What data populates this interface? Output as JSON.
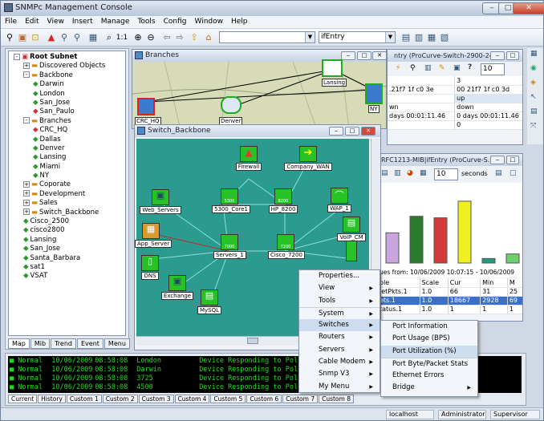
{
  "app": {
    "title": "SNMPc Management Console"
  },
  "menu": [
    "File",
    "Edit",
    "View",
    "Insert",
    "Manage",
    "Tools",
    "Config",
    "Window",
    "Help"
  ],
  "toolbar": {
    "zoom_label": "1:1",
    "combo_left": "",
    "combo_right": "ifEntry"
  },
  "tree": {
    "items": [
      {
        "label": "Root Subnet",
        "icon": "root",
        "depth": 0,
        "exp": "-"
      },
      {
        "label": "Discovered Objects",
        "icon": "folder",
        "depth": 1,
        "exp": "+"
      },
      {
        "label": "Backbone",
        "icon": "folder",
        "depth": 1,
        "exp": "-"
      },
      {
        "label": "Darwin",
        "icon": "diamond-green",
        "depth": 2
      },
      {
        "label": "London",
        "icon": "diamond-green",
        "depth": 2
      },
      {
        "label": "San_Jose",
        "icon": "diamond-green",
        "depth": 2
      },
      {
        "label": "San_Paulo",
        "icon": "diamond-red",
        "depth": 2
      },
      {
        "label": "Branches",
        "icon": "folder",
        "depth": 1,
        "exp": "-"
      },
      {
        "label": "CRC_HQ",
        "icon": "diamond-red",
        "depth": 2
      },
      {
        "label": "Dallas",
        "icon": "diamond-green",
        "depth": 2
      },
      {
        "label": "Denver",
        "icon": "diamond-green",
        "depth": 2
      },
      {
        "label": "Lansing",
        "icon": "diamond-green",
        "depth": 2
      },
      {
        "label": "Miami",
        "icon": "diamond-green",
        "depth": 2
      },
      {
        "label": "NY",
        "icon": "diamond-green",
        "depth": 2
      },
      {
        "label": "Coporate",
        "icon": "folder",
        "depth": 1,
        "exp": "+"
      },
      {
        "label": "Development",
        "icon": "folder",
        "depth": 1,
        "exp": "+"
      },
      {
        "label": "Sales",
        "icon": "folder",
        "depth": 1,
        "exp": "+"
      },
      {
        "label": "Switch_Backbone",
        "icon": "folder",
        "depth": 1,
        "exp": "+"
      },
      {
        "label": "Cisco_2500",
        "icon": "diamond-green",
        "depth": 1
      },
      {
        "label": "cisco2800",
        "icon": "diamond-green",
        "depth": 1
      },
      {
        "label": "Lansing",
        "icon": "diamond-green",
        "depth": 1
      },
      {
        "label": "San_Jose",
        "icon": "diamond-green",
        "depth": 1
      },
      {
        "label": "Santa_Barbara",
        "icon": "diamond-green",
        "depth": 1
      },
      {
        "label": "sat1",
        "icon": "diamond-green",
        "depth": 1
      },
      {
        "label": "VSAT",
        "icon": "diamond-green",
        "depth": 1
      }
    ]
  },
  "left_tabs": [
    "Map",
    "Mib",
    "Trend",
    "Event",
    "Menu"
  ],
  "branches": {
    "title": "Branches",
    "nodes": [
      "Lansing",
      "NY",
      "CRC_HQ",
      "Denver"
    ]
  },
  "switch_backbone": {
    "title": "Switch_Backbone",
    "nodes": [
      "Firewall",
      "Company_WAN",
      "5300_Core1",
      "HP_8200",
      "Web_Servers",
      "WAP_1",
      "App_Server",
      "VoIP_CM",
      "Servers_1",
      "Cisco_7200",
      "DNS",
      "Exchange",
      "MySQL"
    ],
    "small_labels": {
      "core1": "5300",
      "hp": "8200",
      "servers": "7000",
      "cisco": "7200"
    }
  },
  "if_table": {
    "title": "ntry (ProCurve-Switch-2900-24G)",
    "combo": "10",
    "rows": [
      [
        "",
        "3"
      ],
      [
        ".21f7 1f c0 3e",
        "00 21f7 1f c0 3d"
      ],
      [
        "",
        "up"
      ],
      [
        "wn",
        "down"
      ],
      [
        "days 00:01:11.46",
        "0 days 00:01:11.46"
      ],
      [
        "",
        "0"
      ]
    ]
  },
  "rfc": {
    "title": "RFC1213-MIB|ifEntry (ProCurve-S...",
    "spin_value": "10",
    "spin_unit": "seconds",
    "range": "ues from: 10/06/2009 10:07:15 - 10/06/2009 10:13:14",
    "headers": [
      "ble",
      "Scale",
      "Cur",
      "Min",
      "M"
    ],
    "rows": [
      [
        "ietPkts.1",
        "1.0",
        "66",
        "31",
        "25"
      ],
      [
        "ets.1",
        "1.0",
        "18667",
        "2928",
        "69"
      ],
      [
        "tatus.1",
        "1.0",
        "1",
        "1",
        "1"
      ]
    ],
    "bars": [
      {
        "color": "#c9a6e0",
        "value": 40
      },
      {
        "color": "#2c7a2c",
        "value": 62
      },
      {
        "color": "#d23a3a",
        "value": 60
      },
      {
        "color": "#f0f020",
        "value": 82
      },
      {
        "color": "#1e9a80",
        "value": 6
      },
      {
        "color": "#6cd06c",
        "value": 12
      }
    ]
  },
  "context_menu": {
    "items": [
      {
        "label": "Properties...",
        "arrow": false
      },
      {
        "label": "View",
        "arrow": true
      },
      {
        "label": "Tools",
        "arrow": true
      },
      {
        "label": "System",
        "arrow": true
      },
      {
        "label": "Switches",
        "arrow": true,
        "highlight": true
      },
      {
        "label": "Routers",
        "arrow": true
      },
      {
        "label": "Servers",
        "arrow": true
      },
      {
        "label": "Cable Modem",
        "arrow": true
      },
      {
        "label": "Snmp V3",
        "arrow": true
      },
      {
        "label": "My Menu",
        "arrow": true
      }
    ]
  },
  "submenu": {
    "items": [
      {
        "label": "Port Information"
      },
      {
        "label": "Port Usage (BPS)"
      },
      {
        "label": "Port Utilization (%)",
        "highlight": true
      },
      {
        "label": "Port Byte/Packet Stats"
      },
      {
        "label": "Ethernet Errors"
      },
      {
        "label": "Bridge",
        "arrow": true
      }
    ]
  },
  "events": [
    [
      "Normal",
      "10/06/2009",
      "08:58:08",
      "London",
      "Device Responding to Poll"
    ],
    [
      "Normal",
      "10/06/2009",
      "08:58:08",
      "Darwin",
      "Device Responding to Poll"
    ],
    [
      "Normal",
      "10/06/2009",
      "08:58:08",
      "3725",
      "Device Responding to Poll"
    ],
    [
      "Normal",
      "10/06/2009",
      "08:58:08",
      "4500",
      "Device Responding to Poll"
    ]
  ],
  "bottom_tabs": [
    "Current",
    "History",
    "Custom 1",
    "Custom 2",
    "Custom 3",
    "Custom 4",
    "Custom 5",
    "Custom 6",
    "Custom 7",
    "Custom 8"
  ],
  "status": {
    "host": "localhost",
    "user": "Administrator",
    "role": "Supervisor"
  },
  "colors": {
    "map_bg": "#2b9b8f",
    "node_green": "#26c226",
    "highlight": "#cddcef"
  }
}
